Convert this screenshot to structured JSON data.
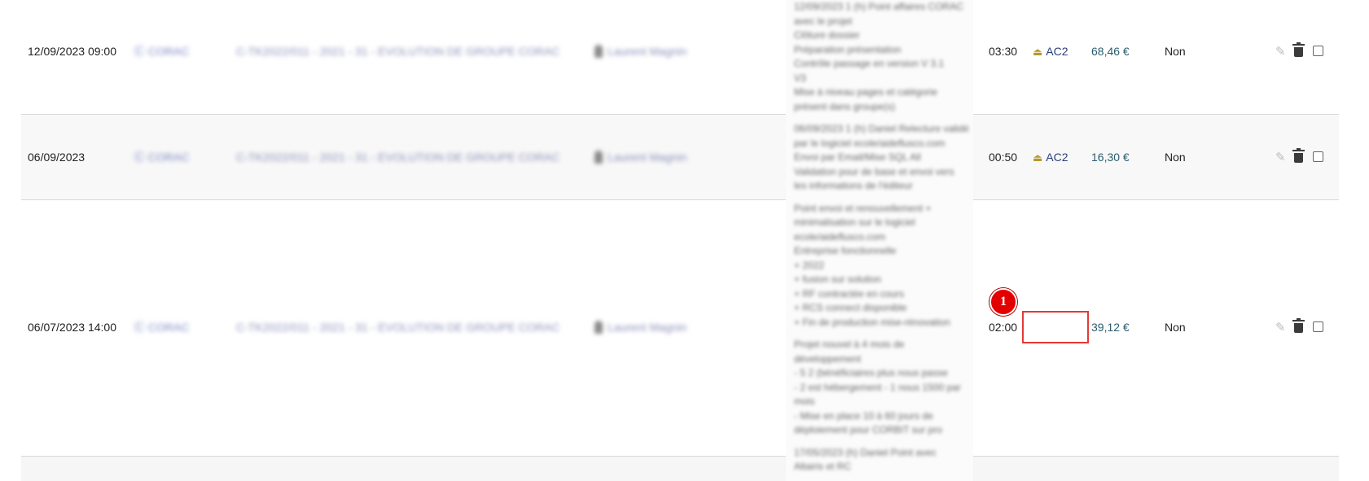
{
  "rows": [
    {
      "date": "12/09/2023 09:00",
      "client": "Ⓒ CORAC",
      "project": "C-TK2022/011 - 2021 - 31 - EVOLUTION DE GROUPE CORAC",
      "person": "Laurent Magnin",
      "duration": "03:30",
      "activity": "AC2",
      "amount": "68,46 €",
      "billed": "Non"
    },
    {
      "date": "06/09/2023",
      "client": "Ⓒ CORAC",
      "project": "C-TK2022/011 - 2021 - 31 - EVOLUTION DE GROUPE CORAC",
      "person": "Laurent Magnin",
      "duration": "00:50",
      "activity": "AC2",
      "amount": "16,30 €",
      "billed": "Non"
    },
    {
      "date": "06/07/2023 14:00",
      "client": "Ⓒ CORAC",
      "project": "C-TK2022/011 - 2021 - 31 - EVOLUTION DE GROUPE CORAC",
      "person": "Laurent Magnin",
      "duration": "02:00",
      "activity": "",
      "amount": "39,12 €",
      "billed": "Non"
    }
  ],
  "description_lines": [
    "12/09/2023 1 (h) Point affaires CORAC",
    "avec le projet",
    "Clôture dossier",
    "Préparation présentation",
    "Contrôle passage en version V 3.1",
    "V3",
    "Mise à niveau pages et catégorie",
    "présent dans groupe(s)",
    "",
    "06/09/2023 1 (h) Daniel Relecture validé",
    "par le logiciel ecole/aideflusco.com",
    "Envoi par Email/Mise SQL All",
    "Validation pour de base et envoi vers",
    "les informations de l'éditeur",
    "",
    "Point envoi et renouvellement +",
    "minimalisation sur le logiciel",
    "ecole/aideflusco.com",
    "Entreprise fonctionnelle",
    "+ 2022",
    "+ fusion sur solution",
    "+ RF contractée en cours",
    "+ RCS connect disponible",
    "+ Fin de production mise-rénovation",
    "",
    "Projet nouvel à 4 mois de",
    "développement",
    "- 5 2 (bénéficiaires plus nous passe",
    "- 2 est hébergement - 1 nous 1500 par",
    "mois",
    "- Mise en place 10 à 60 jours de",
    "déploiement pour CORBIT sur pro",
    "",
    "17/05/2023 (h) Daniel Point avec",
    "Altairis et RC"
  ],
  "annotation": {
    "badge": "1"
  },
  "colors": {
    "annotation": "#e53935",
    "amount": "#2b5d6e",
    "activity": "#2c3e78"
  },
  "icons": {
    "edit": "pencil-icon",
    "delete": "trash-icon",
    "select": "checkbox",
    "activity": "bell-icon",
    "person": "person-icon"
  }
}
